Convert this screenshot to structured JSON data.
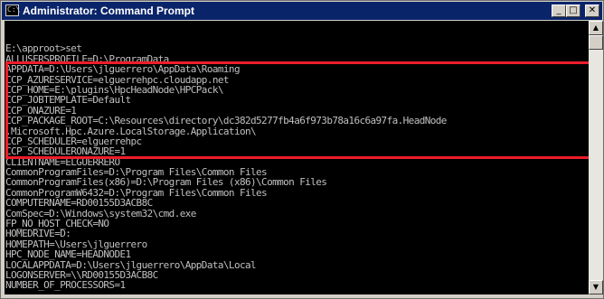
{
  "window": {
    "title": "Administrator: Command Prompt",
    "icon": "cmd-icon",
    "icon_glyph": "C:\\",
    "buttons": {
      "minimize": "_",
      "maximize": "□",
      "close": "✕"
    },
    "scrollbar": {
      "up": "▲",
      "down": "▼"
    }
  },
  "console": {
    "lines": [
      "",
      "E:\\approot>set",
      "ALLUSERSPROFILE=D:\\ProgramData",
      "APPDATA=D:\\Users\\jlguerrero\\AppData\\Roaming",
      "CCP_AZURESERVICE=elguerrehpc.cloudapp.net",
      "CCP_HOME=E:\\plugins\\HpcHeadNode\\HPCPack\\",
      "CCP_JOBTEMPLATE=Default",
      "CCP_ONAZURE=1",
      "CCP_PACKAGE_ROOT=C:\\Resources\\directory\\dc382d5277fb4a6f973b78a16c6a97fa.HeadNode",
      ".Microsoft.Hpc.Azure.LocalStorage.Application\\",
      "CCP_SCHEDULER=elguerrehpc",
      "CCP_SCHEDULERONAZURE=1",
      "CLIENTNAME=ELGUERRERO",
      "CommonProgramFiles=D:\\Program Files\\Common Files",
      "CommonProgramFiles(x86)=D:\\Program Files (x86)\\Common Files",
      "CommonProgramW6432=D:\\Program Files\\Common Files",
      "COMPUTERNAME=RD00155D3ACB8C",
      "ComSpec=D:\\Windows\\system32\\cmd.exe",
      "FP_NO_HOST_CHECK=NO",
      "HOMEDRIVE=D:",
      "HOMEPATH=\\Users\\jlguerrero",
      "HPC_NODE_NAME=HEADNODE1",
      "LOCALAPPDATA=D:\\Users\\jlguerrero\\AppData\\Local",
      "LOGONSERVER=\\\\RD00155D3ACB8C",
      "NUMBER_OF_PROCESSORS=1"
    ]
  },
  "highlight": {
    "color": "#ee1d2a",
    "covers_lines": "CCP_AZURESERVICE through CCP_SCHEDULERONAZURE"
  },
  "colors": {
    "titlebar": "#0a246a",
    "console_bg": "#000000",
    "console_text": "#c0c0c0"
  }
}
